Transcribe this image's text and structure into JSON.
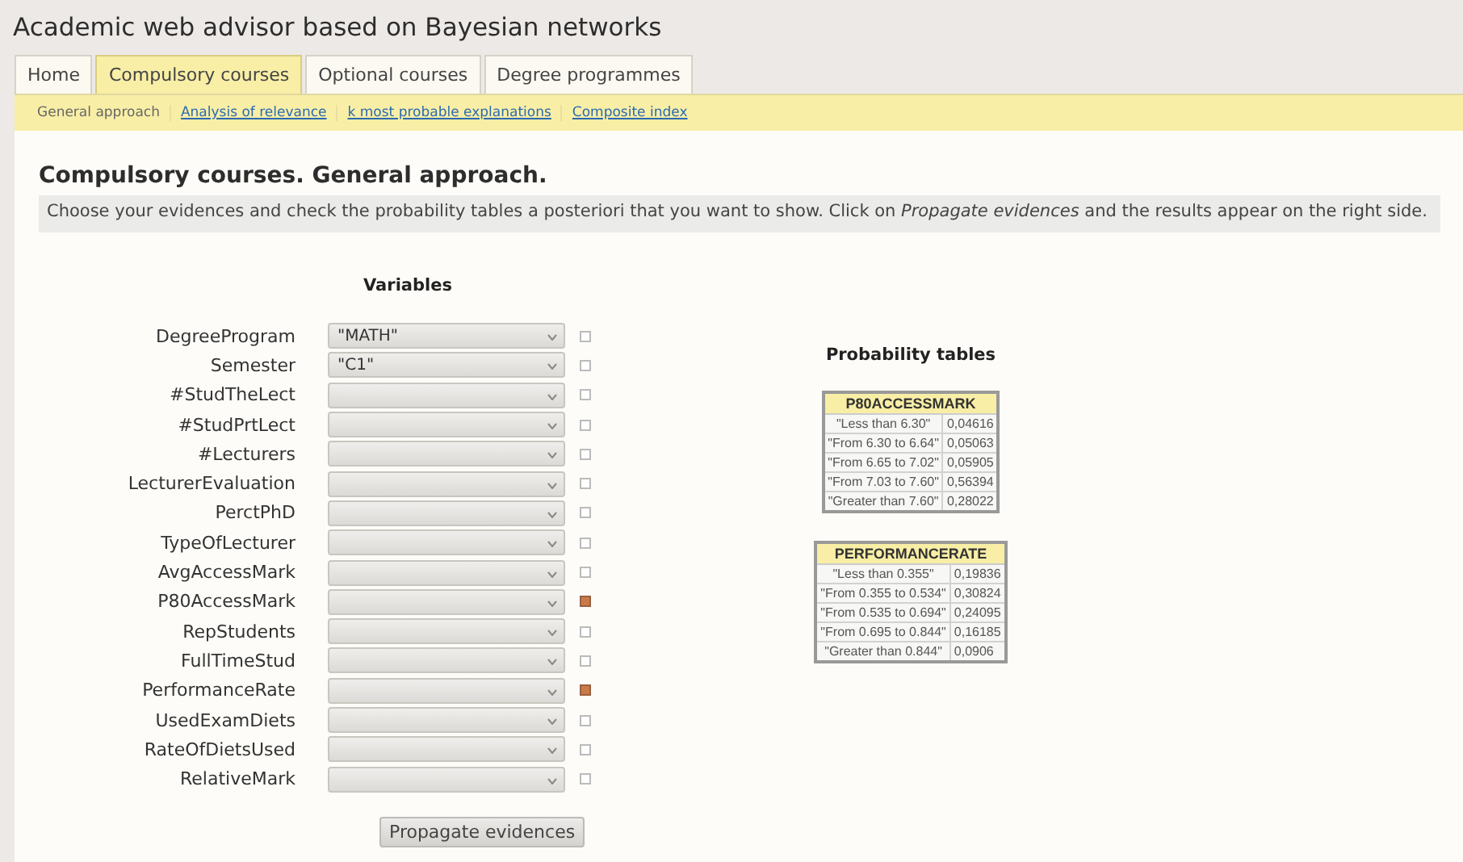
{
  "title": "Academic web advisor based on Bayesian networks",
  "tabs": [
    {
      "label": "Home",
      "selected": false
    },
    {
      "label": "Compulsory courses",
      "selected": true
    },
    {
      "label": "Optional courses",
      "selected": false
    },
    {
      "label": "Degree programmes",
      "selected": false
    }
  ],
  "subnav": [
    {
      "label": "General approach",
      "selected": true
    },
    {
      "label": "Analysis of relevance",
      "selected": false
    },
    {
      "label": "k most probable explanations",
      "selected": false
    },
    {
      "label": "Composite index",
      "selected": false
    }
  ],
  "heading": "Compulsory courses. General approach.",
  "description": "Choose your evidences and check the probability tables a posteriori that you want to show. Click on *Propagate evidences* and the results appear on the right side.",
  "variables_title": "Variables",
  "variables": [
    {
      "name": "DegreeProgram",
      "value": "\"MATH\"",
      "checked": false
    },
    {
      "name": "Semester",
      "value": "\"C1\"",
      "checked": false
    },
    {
      "name": "#StudTheLect",
      "checked": false
    },
    {
      "name": "#StudPrtLect",
      "checked": false
    },
    {
      "name": "#Lecturers",
      "checked": false
    },
    {
      "name": "LecturerEvaluation",
      "checked": false
    },
    {
      "name": "PerctPhD",
      "checked": false
    },
    {
      "name": "TypeOfLecturer",
      "checked": false
    },
    {
      "name": "AvgAccessMark",
      "checked": false
    },
    {
      "name": "P80AccessMark",
      "checked": true
    },
    {
      "name": "RepStudents",
      "checked": false
    },
    {
      "name": "FullTimeStud",
      "checked": false
    },
    {
      "name": "PerformanceRate",
      "checked": true
    },
    {
      "name": "UsedExamDiets",
      "checked": false
    },
    {
      "name": "RateOfDietsUsed",
      "checked": false
    },
    {
      "name": "RelativeMark",
      "checked": false
    }
  ],
  "propagate_button": "Propagate evidences",
  "tables_title": "Probability tables",
  "tables": [
    {
      "title": "P80ACCESSMARK",
      "rows": [
        [
          "\"Less than 6.30\"",
          "0,04616"
        ],
        [
          "\"From 6.30 to 6.64\"",
          "0,05063"
        ],
        [
          "\"From 6.65 to 7.02\"",
          "0,05905"
        ],
        [
          "\"From 7.03 to 7.60\"",
          "0,56394"
        ],
        [
          "\"Greater than 7.60\"",
          "0,28022"
        ]
      ]
    },
    {
      "title": "PERFORMANCERATE",
      "rows": [
        [
          "\"Less than 0.355\"",
          "0,19836"
        ],
        [
          "\"From 0.355 to 0.534\"",
          "0,30824"
        ],
        [
          "\"From 0.535 to 0.694\"",
          "0,24095"
        ],
        [
          "\"From 0.695 to 0.844\"",
          "0,16185"
        ],
        [
          "\"Greater than 0.844\"",
          "0,0906"
        ]
      ]
    }
  ]
}
